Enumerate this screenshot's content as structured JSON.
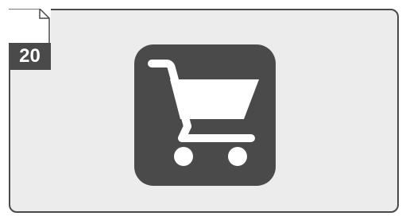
{
  "tag": {
    "number": "20"
  },
  "icon": {
    "name": "shopping-cart-icon",
    "tile_color": "#4a4a4a",
    "glyph_color": "#ffffff"
  },
  "colors": {
    "card_background": "#ececec",
    "border": "#4a4a4a"
  }
}
